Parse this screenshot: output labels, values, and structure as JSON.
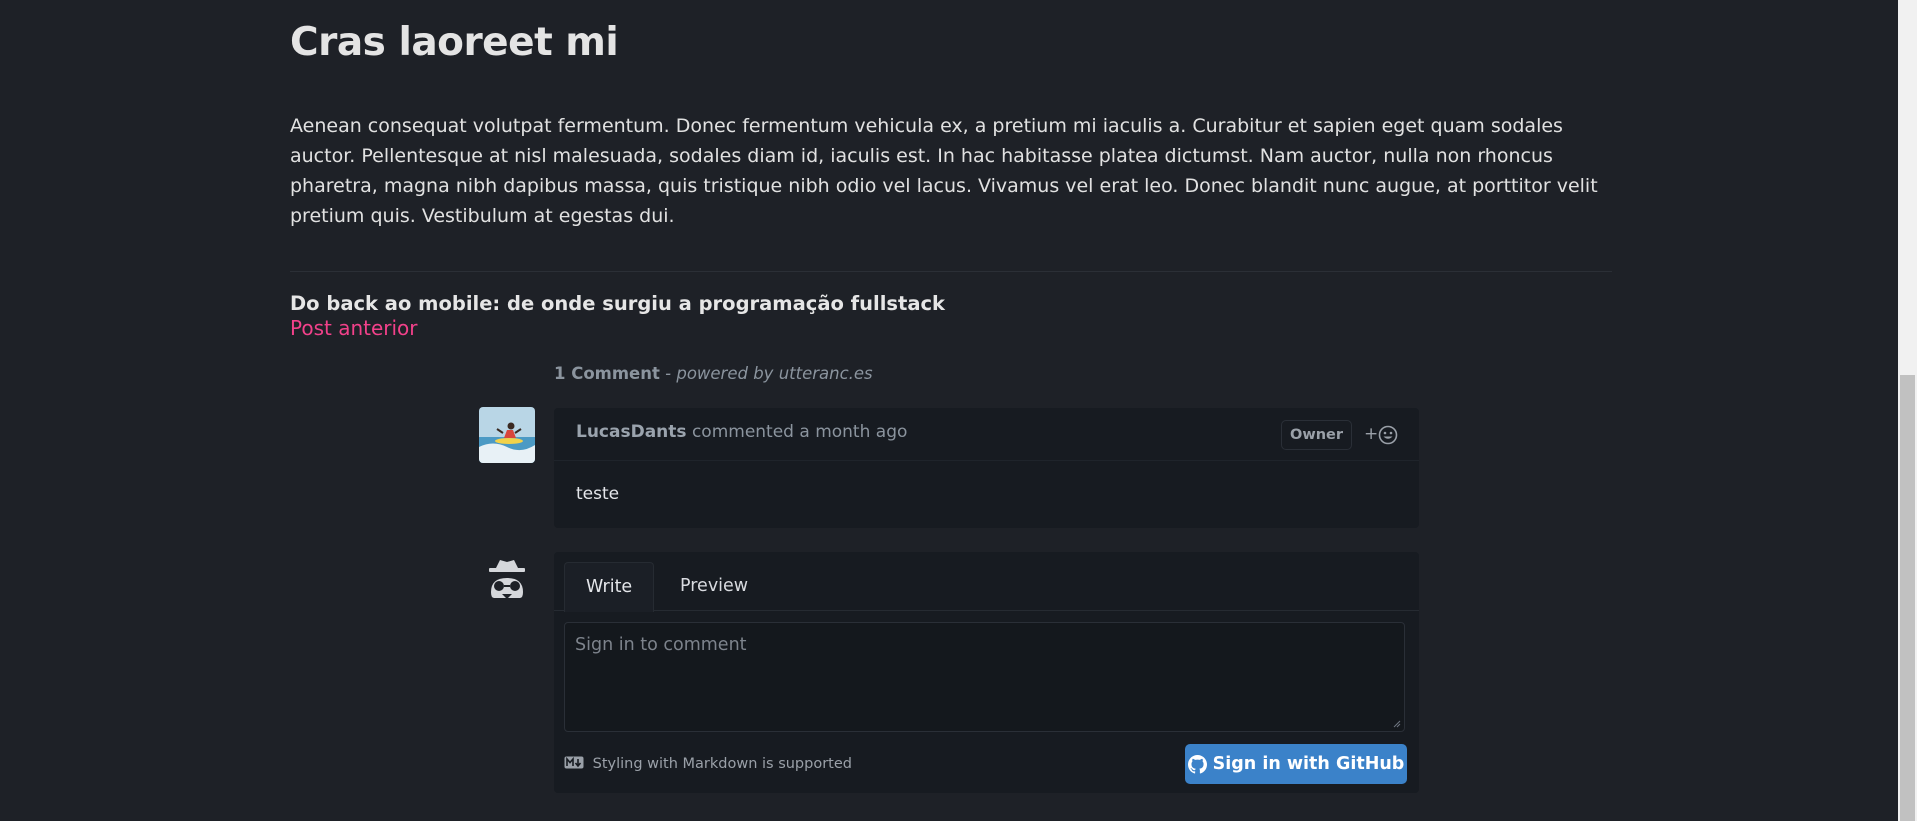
{
  "post": {
    "title": "Cras laoreet mi",
    "body": "Aenean consequat volutpat fermentum. Donec fermentum vehicula ex, a pretium mi iaculis a. Curabitur et sapien eget quam sodales auctor. Pellentesque at nisl malesuada, sodales diam id, iaculis est. In hac habitasse platea dictumst. Nam auctor, nulla non rhoncus pharetra, magna nibh dapibus massa, quis tristique nibh odio vel lacus. Vivamus vel erat leo. Donec blandit nunc augue, at porttitor velit pretium quis. Vestibulum at egestas dui."
  },
  "navigation": {
    "previous_title": "Do back ao mobile: de onde surgiu a programação fullstack",
    "previous_label": "Post anterior"
  },
  "comments": {
    "count": "1 Comment",
    "powered_by": "- powered by utteranc.es",
    "items": [
      {
        "author": "LucasDants",
        "action": "commented a month ago",
        "badge": "Owner",
        "react_label": "+",
        "text": "teste"
      }
    ]
  },
  "editor": {
    "tab_write": "Write",
    "tab_preview": "Preview",
    "placeholder": "Sign in to comment",
    "markdown_hint": "Styling with Markdown is supported",
    "signin_label": "Sign in with GitHub"
  },
  "colors": {
    "background": "#1e2127",
    "accent": "#f2418a",
    "button": "#3b82c9"
  }
}
